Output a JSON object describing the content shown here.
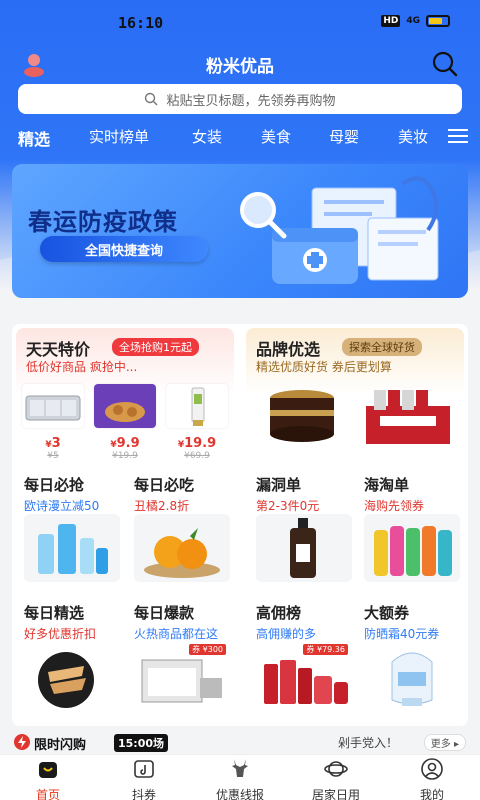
{
  "status_bar": {
    "time": "16:10",
    "hd": "HD",
    "signal": "4G"
  },
  "header": {
    "title": "粉米优品"
  },
  "search": {
    "placeholder": "粘贴宝贝标题，先领券再购物"
  },
  "categories": [
    "精选",
    "实时榜单",
    "女装",
    "美食",
    "母婴",
    "美妆"
  ],
  "banner": {
    "title": "春运防疫政策",
    "button": "全国快捷查询"
  },
  "promo_left": {
    "title": "天天特价",
    "tag": "全场抢购1元起",
    "subtitle": "低价好商品 疯抢中...",
    "deals": [
      {
        "price": "3",
        "orig": "¥5"
      },
      {
        "price": "9.9",
        "orig": "¥19.9"
      },
      {
        "price": "19.9",
        "orig": "¥69.9"
      }
    ]
  },
  "promo_right": {
    "title": "品牌优选",
    "tag": "探索全球好货",
    "subtitle": "精选优质好货 券后更划算"
  },
  "grid": [
    {
      "title": "每日必抢",
      "subtitle": "欧诗漫立减50",
      "color": "#2f7bf6"
    },
    {
      "title": "每日必吃",
      "subtitle": "丑橘2.8折",
      "color": "#e0362f"
    },
    {
      "title": "漏洞单",
      "subtitle": "第2-3件0元",
      "color": "#e0362f"
    },
    {
      "title": "海淘单",
      "subtitle": "海购先领券",
      "color": "#e0362f"
    },
    {
      "title": "每日精选",
      "subtitle": "好多优惠折扣",
      "color": "#e0362f"
    },
    {
      "title": "每日爆款",
      "subtitle": "火热商品都在这",
      "color": "#2f7bf6"
    },
    {
      "title": "高佣榜",
      "subtitle": "高佣赚的多",
      "color": "#2f7bf6"
    },
    {
      "title": "大额券",
      "subtitle": "防晒霜40元券",
      "color": "#2f7bf6"
    }
  ],
  "grid_badges": {
    "baokuan": "券 ¥300",
    "gaoyong": "券 ¥79.36"
  },
  "flash": {
    "label": "限时闪购",
    "time": "15:00场",
    "note": "剁手党入！",
    "more": "更多 ▸"
  },
  "tabs": [
    "首页",
    "抖券",
    "优惠线报",
    "居家日用",
    "我的"
  ],
  "colors": {
    "primary": "#2f75f7",
    "accent_red": "#e0362f",
    "active_tab": "#e63a1f"
  }
}
